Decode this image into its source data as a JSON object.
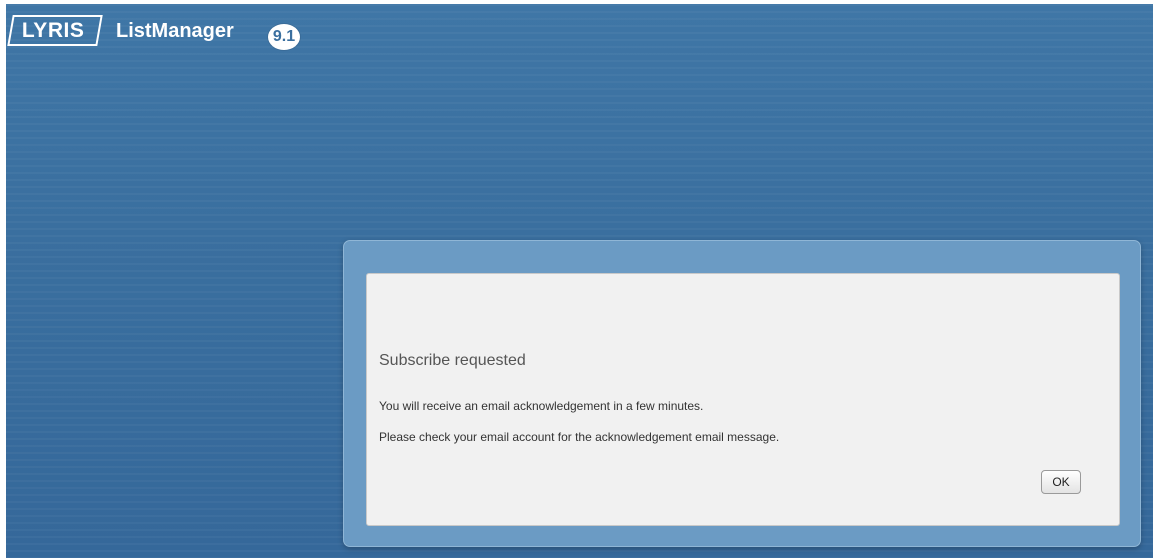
{
  "header": {
    "logo_text": "LYRIS",
    "product_name": "ListManager",
    "version": "9.1"
  },
  "dialog": {
    "title": "Subscribe requested",
    "line1": "You will receive an email acknowledgement in a few minutes.",
    "line2": "Please check your email account for the acknowledgement email message.",
    "ok_label": "OK"
  },
  "colors": {
    "background": "#3a6f9f",
    "dialog_frame": "#6b9bc4",
    "dialog_panel": "#f1f1f1"
  }
}
